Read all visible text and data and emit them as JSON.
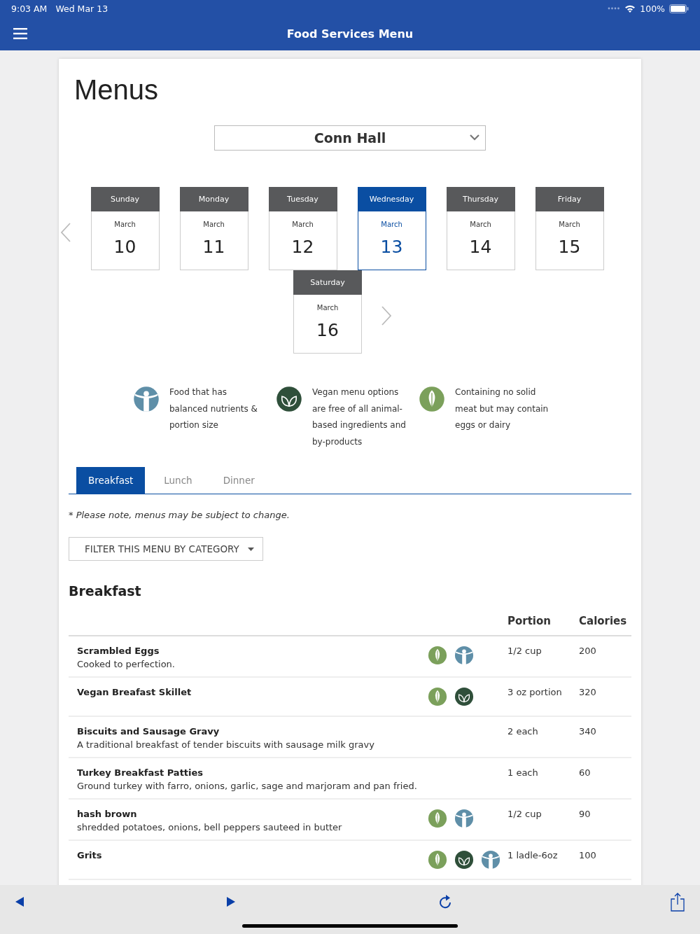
{
  "status_bar": {
    "time": "9:03 AM",
    "date": "Wed Mar 13",
    "battery": "100%"
  },
  "header": {
    "title": "Food Services Menu"
  },
  "page_title": "Menus",
  "location_select": {
    "value": "Conn Hall"
  },
  "days": [
    {
      "weekday": "Sunday",
      "month": "March",
      "day": "10",
      "selected": false
    },
    {
      "weekday": "Monday",
      "month": "March",
      "day": "11",
      "selected": false
    },
    {
      "weekday": "Tuesday",
      "month": "March",
      "day": "12",
      "selected": false
    },
    {
      "weekday": "Wednesday",
      "month": "March",
      "day": "13",
      "selected": true
    },
    {
      "weekday": "Thursday",
      "month": "March",
      "day": "14",
      "selected": false
    },
    {
      "weekday": "Friday",
      "month": "March",
      "day": "15",
      "selected": false
    },
    {
      "weekday": "Saturday",
      "month": "March",
      "day": "16",
      "selected": false
    }
  ],
  "legend": [
    {
      "kind": "balanced",
      "text": "Food that has balanced nutrients & portion size"
    },
    {
      "kind": "vegan",
      "text": "Vegan menu options are free of all animal-based ingredients and by-products"
    },
    {
      "kind": "vegetarian",
      "text": "Containing no solid meat but may contain eggs or dairy"
    }
  ],
  "meal_tabs": [
    {
      "label": "Breakfast",
      "selected": true
    },
    {
      "label": "Lunch",
      "selected": false
    },
    {
      "label": "Dinner",
      "selected": false
    }
  ],
  "note": "* Please note, menus may be subject to change.",
  "filter_button": "FILTER THIS MENU BY CATEGORY",
  "section_title": "Breakfast",
  "columns": [
    "Portion",
    "Calories"
  ],
  "items": [
    {
      "name": "Scrambled Eggs",
      "description": "Cooked to perfection.",
      "badges": [
        {
          "kind": "vegetarian"
        },
        {
          "kind": "balanced"
        }
      ],
      "portion": "1/2 cup",
      "calories": "200"
    },
    {
      "name": "Vegan Breafast Skillet",
      "badges": [
        {
          "kind": "vegetarian"
        },
        {
          "kind": "vegan"
        }
      ],
      "portion": "3 oz portion",
      "calories": "320"
    },
    {
      "name": "Biscuits and Sausage Gravy",
      "description": "A traditional breakfast of tender biscuits with sausage milk gravy",
      "portion": "2 each",
      "calories": "340"
    },
    {
      "name": "Turkey Breakfast Patties",
      "description": "Ground turkey with farro, onions, garlic, sage and marjoram and pan fried.",
      "portion": "1 each",
      "calories": "60"
    },
    {
      "name": "hash brown",
      "description": "shredded potatoes, onions, bell peppers sauteed in butter",
      "badges": [
        {
          "kind": "vegetarian"
        },
        {
          "kind": "balanced"
        }
      ],
      "portion": "1/2 cup",
      "calories": "90"
    },
    {
      "name": "Grits",
      "badges": [
        {
          "kind": "vegetarian"
        },
        {
          "kind": "vegan"
        },
        {
          "kind": "balanced"
        }
      ],
      "portion": "1 ladle-6oz",
      "calories": "100"
    }
  ]
}
